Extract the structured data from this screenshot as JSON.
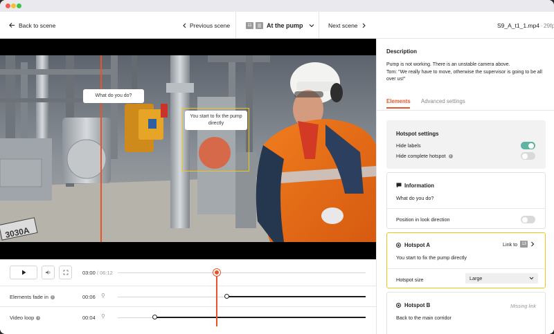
{
  "topbar": {
    "back_label": "Back to scene",
    "previous_label": "Previous scene",
    "scene_number": "11",
    "scene_title": "At the pump",
    "next_label": "Next scene",
    "file_name": "S9_A_t1_1.mp4",
    "fps": "29fps"
  },
  "video": {
    "hotspot_question": "What do you do?",
    "hotspot_a_text": "You start to fix the pump directly",
    "sign_text": "3030A"
  },
  "player": {
    "current_time": "03:00",
    "total_time": "06:12",
    "progress_fraction": 0.4,
    "rows": [
      {
        "label": "Elements fade in",
        "time": "00:06",
        "fraction": 0.44
      },
      {
        "label": "Video loop",
        "time": "00:04",
        "fraction": 0.15
      }
    ]
  },
  "panel": {
    "description_title": "Description",
    "description_line1": "Pump is not working. There is an unstable camera above.",
    "description_line2": "Tom: \"We really have to move, otherwise the supervisor is going to be all over us!\"",
    "tabs": [
      "Elements",
      "Advanced settings"
    ],
    "active_tab": "Elements",
    "hotspot_settings": {
      "title": "Hotspot settings",
      "hide_labels": "Hide labels",
      "hide_labels_on": true,
      "hide_complete": "Hide complete hotspot",
      "hide_complete_on": false
    },
    "information": {
      "title": "Information",
      "text": "What do you do?",
      "position_label": "Position in look direction",
      "position_on": false
    },
    "hotspot_a": {
      "title": "Hotspot A",
      "link_label": "Link to",
      "link_target": "13",
      "text": "You start to fix the pump directly",
      "size_label": "Hotspot size",
      "size_value": "Large"
    },
    "hotspot_b": {
      "title": "Hotspot B",
      "status": "Missing link",
      "text": "Back to the main corridor"
    }
  },
  "colors": {
    "accent": "#e8542a",
    "highlight": "#f2c418",
    "toggle_on": "#5fb3a1",
    "toggle_off": "#d9d9d9"
  }
}
